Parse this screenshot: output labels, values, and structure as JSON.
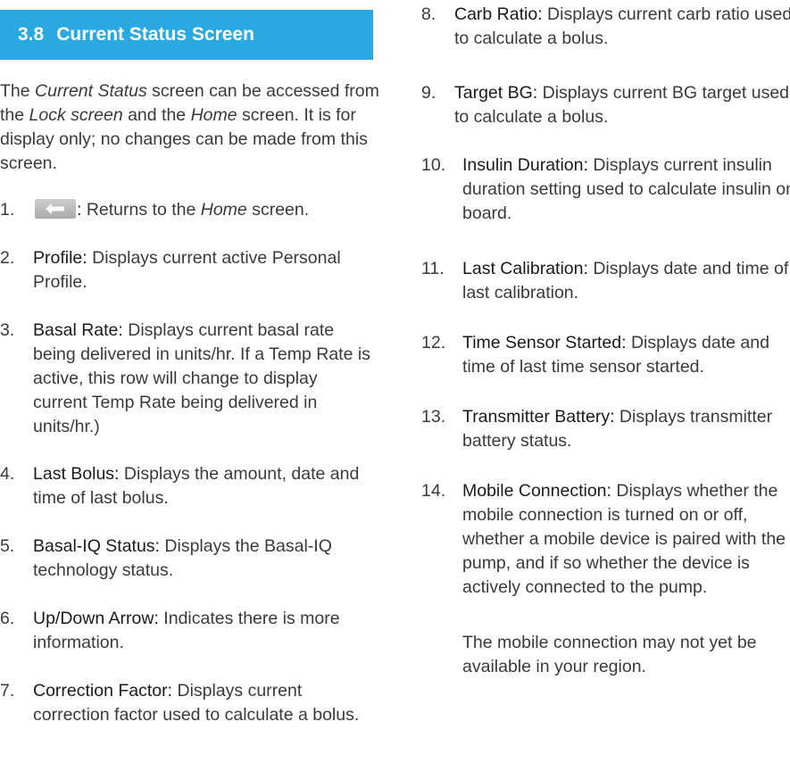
{
  "section": {
    "number": "3.8",
    "title": "Current Status Screen"
  },
  "intro": {
    "p1": "The ",
    "em1": "Current Status",
    "p2": " screen can be accessed from the ",
    "em2": "Lock screen",
    "p3": " and the ",
    "em3": "Home",
    "p4": " screen. It is for display only; no changes can be made from this screen."
  },
  "items": [
    {
      "num": "1.",
      "term": ":",
      "pre": " Returns to the ",
      "em": "Home",
      "post": " screen.",
      "icon": "back-arrow-icon"
    },
    {
      "num": "2.",
      "term": "Profile:",
      "desc": " Displays current active Personal Profile."
    },
    {
      "num": "3.",
      "term": "Basal Rate:",
      "desc": " Displays current basal rate being delivered in units/hr. If a Temp Rate is active, this row will change to display current Temp Rate being delivered in units/hr.)"
    },
    {
      "num": "4.",
      "term": "Last Bolus:",
      "desc": " Displays the amount, date and time of last bolus."
    },
    {
      "num": "5.",
      "term": "Basal-IQ Status:",
      "desc": " Displays the Basal-IQ technology status."
    },
    {
      "num": "6.",
      "term": "Up/Down Arrow:",
      "desc": " Indicates there is more information."
    },
    {
      "num": "7.",
      "term": "Correction Factor:",
      "desc": " Displays current correction factor used to calculate a bolus."
    },
    {
      "num": "8.",
      "term": "Carb Ratio:",
      "desc": " Displays current carb ratio used to calculate a bolus."
    },
    {
      "num": "9.",
      "term": "Target BG:",
      "desc": " Displays current BG target used to calculate a bolus."
    },
    {
      "num": "10.",
      "term": "Insulin Duration:",
      "desc": " Displays current insulin duration setting used to calculate insulin on board."
    },
    {
      "num": "11.",
      "term": "Last Calibration:",
      "desc": " Displays date and time of last calibration."
    },
    {
      "num": "12.",
      "term": "Time Sensor Started:",
      "desc": " Displays date and time of last time sensor started."
    },
    {
      "num": "13.",
      "term": "Transmitter Battery:",
      "desc": " Displays transmitter battery status."
    },
    {
      "num": "14.",
      "term": "Mobile Connection:",
      "desc": " Displays whether the mobile connection is turned on or off, whether a mobile device is paired with the pump, and if so whether the device is actively connected to the pump."
    }
  ],
  "note": "The mobile connection may not yet be available in your region.",
  "colors": {
    "header_bg": "#29a9e0",
    "header_text": "#ffffff",
    "body_text": "#3a3a3a"
  }
}
